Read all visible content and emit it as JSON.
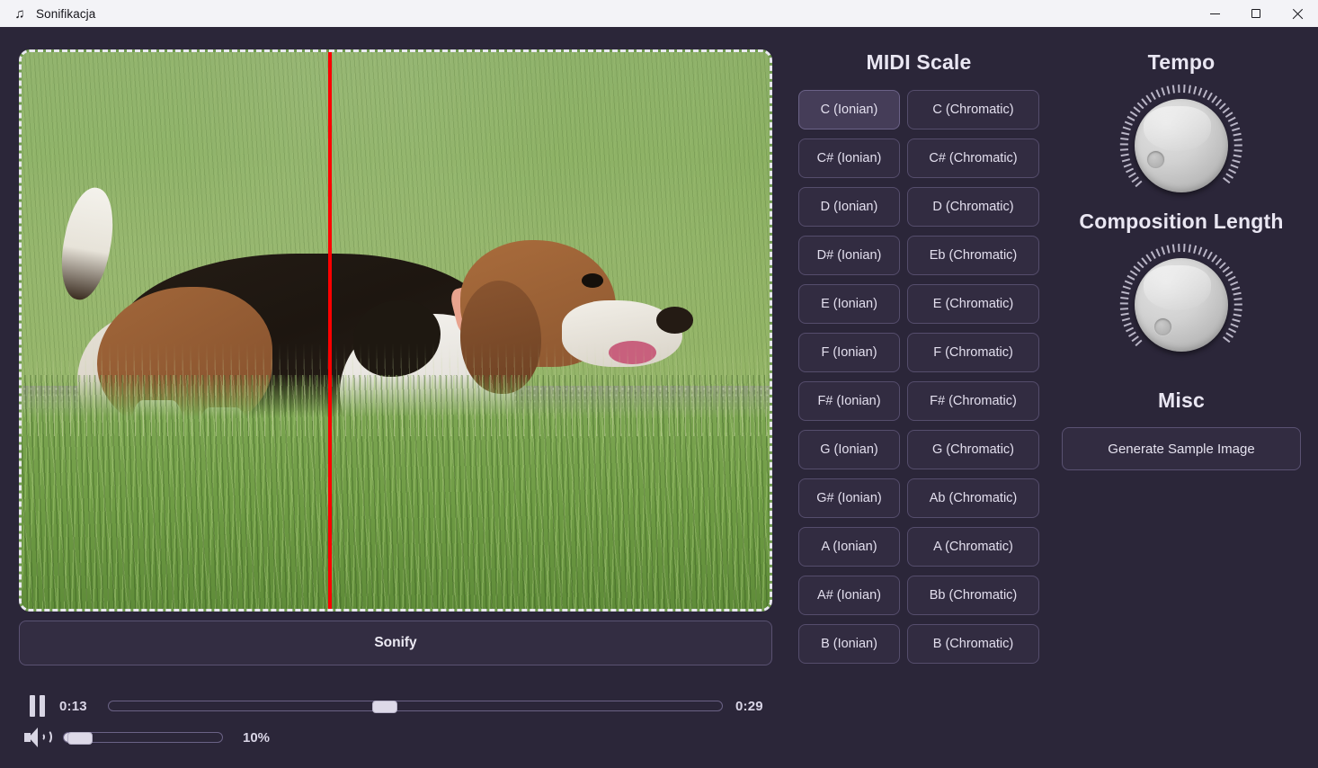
{
  "window": {
    "title": "Sonifikacja",
    "icon": "music-note-icon",
    "minimize_label": "Minimize",
    "maximize_label": "Maximize",
    "close_label": "Close"
  },
  "theme": {
    "background": "#2b2639",
    "button_fill": "#322c41",
    "button_border": "#554d6c",
    "selected_fill": "#453d58",
    "text": "#e3dfee",
    "playhead": "#fb0000",
    "slider_thumb": "#ddd9e8",
    "knob": "#d2d2d2"
  },
  "image_panel": {
    "name": "sonification-image-canvas",
    "border_style": "dashed",
    "content_description": "Beagle-type dog walking on grass beside a gravel path",
    "playhead_position_percent": 41
  },
  "sonify": {
    "label": "Sonify"
  },
  "transport": {
    "pause_icon": "pause-icon",
    "speaker_icon": "speaker-icon",
    "current_time": "0:13",
    "total_time": "0:29",
    "progress_percent": 45,
    "volume_label": "10%",
    "volume_percent": 10
  },
  "midi_scale": {
    "title": "MIDI Scale",
    "selected": "C (Ionian)",
    "rows": [
      {
        "ionian": "C (Ionian)",
        "chromatic": "C (Chromatic)"
      },
      {
        "ionian": "C# (Ionian)",
        "chromatic": "C# (Chromatic)"
      },
      {
        "ionian": "D (Ionian)",
        "chromatic": "D (Chromatic)"
      },
      {
        "ionian": "D# (Ionian)",
        "chromatic": "Eb (Chromatic)"
      },
      {
        "ionian": "E (Ionian)",
        "chromatic": "E (Chromatic)"
      },
      {
        "ionian": "F (Ionian)",
        "chromatic": "F (Chromatic)"
      },
      {
        "ionian": "F# (Ionian)",
        "chromatic": "F# (Chromatic)"
      },
      {
        "ionian": "G (Ionian)",
        "chromatic": "G (Chromatic)"
      },
      {
        "ionian": "G# (Ionian)",
        "chromatic": "Ab (Chromatic)"
      },
      {
        "ionian": "A (Ionian)",
        "chromatic": "A (Chromatic)"
      },
      {
        "ionian": "A# (Ionian)",
        "chromatic": "Bb (Chromatic)"
      },
      {
        "ionian": "B (Ionian)",
        "chromatic": "B (Chromatic)"
      }
    ]
  },
  "controls": {
    "tempo": {
      "title": "Tempo",
      "knob_angle_deg": -118
    },
    "composition_length": {
      "title": "Composition Length",
      "knob_angle_deg": -140
    },
    "misc": {
      "title": "Misc",
      "generate_label": "Generate Sample Image"
    }
  }
}
